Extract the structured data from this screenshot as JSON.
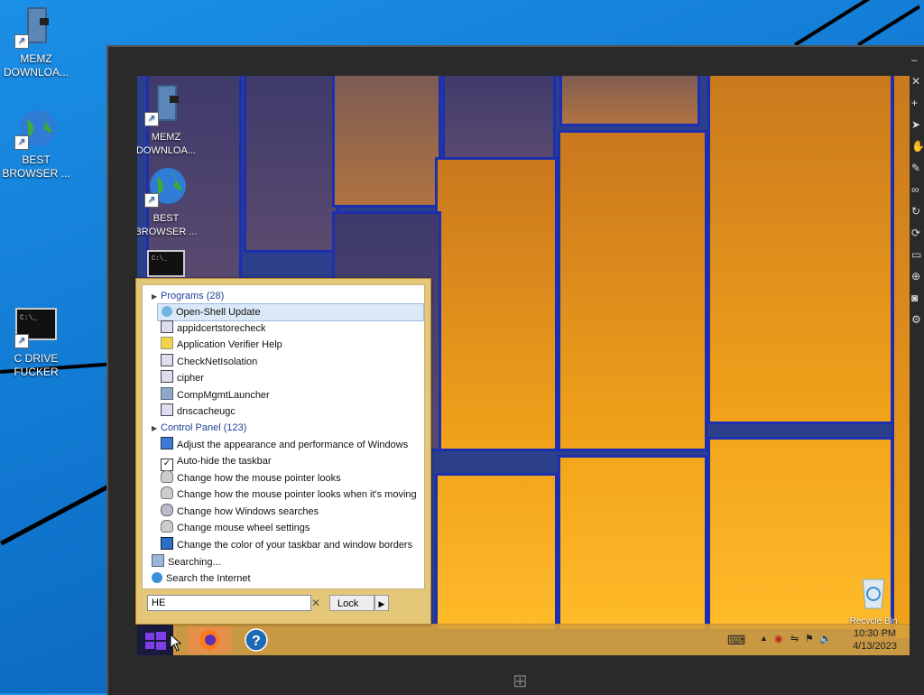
{
  "host_desktop": {
    "icons": [
      {
        "label": "MEMZ DOWNLOA...",
        "icon": "binder-icon"
      },
      {
        "label": "BEST BROWSER ...",
        "icon": "globe-icon"
      },
      {
        "label": "C DRIVE FUCKER",
        "icon": "console-icon"
      }
    ]
  },
  "guest_desktop": {
    "icons": [
      {
        "label": "MEMZ DOWNLOA...",
        "icon": "binder-icon"
      },
      {
        "label": "BEST BROWSER ...",
        "icon": "globe-icon"
      },
      {
        "label": "",
        "icon": "console-icon"
      }
    ],
    "recycle_bin": "Recycle Bin"
  },
  "start_menu": {
    "programs_header": "Programs (28)",
    "programs": [
      {
        "label": "Open-Shell Update",
        "icon": "update-icon",
        "selected": true
      },
      {
        "label": "appidcertstorecheck",
        "icon": "exe-icon"
      },
      {
        "label": "Application Verifier Help",
        "icon": "help-file-icon"
      },
      {
        "label": "CheckNetIsolation",
        "icon": "exe-icon"
      },
      {
        "label": "cipher",
        "icon": "exe-icon"
      },
      {
        "label": "CompMgmtLauncher",
        "icon": "computer-management-icon"
      },
      {
        "label": "dnscacheugc",
        "icon": "exe-icon"
      }
    ],
    "control_panel_header": "Control Panel (123)",
    "control_panel": [
      {
        "label": "Adjust the appearance and performance of Windows",
        "icon": "performance-icon"
      },
      {
        "label": "Auto-hide the taskbar",
        "icon": "checkbox-icon"
      },
      {
        "label": "Change how the mouse pointer looks",
        "icon": "mouse-icon"
      },
      {
        "label": "Change how the mouse pointer looks when it's moving",
        "icon": "mouse-icon"
      },
      {
        "label": "Change how Windows searches",
        "icon": "search-settings-icon"
      },
      {
        "label": "Change mouse wheel settings",
        "icon": "mouse-icon"
      },
      {
        "label": "Change the color of your taskbar and window borders",
        "icon": "display-icon"
      }
    ],
    "searching": "Searching...",
    "search_internet": "Search the Internet",
    "search_value": "HE",
    "lock_label": "Lock"
  },
  "taskbar": {
    "clock_time": "10:30 PM",
    "clock_date": "4/13/2023"
  },
  "colors": {
    "host_bg": "#1380dc",
    "taskbar": "#d6a03c",
    "start_menu_frame": "#e5c77a",
    "selection": "#dbe8f7"
  }
}
